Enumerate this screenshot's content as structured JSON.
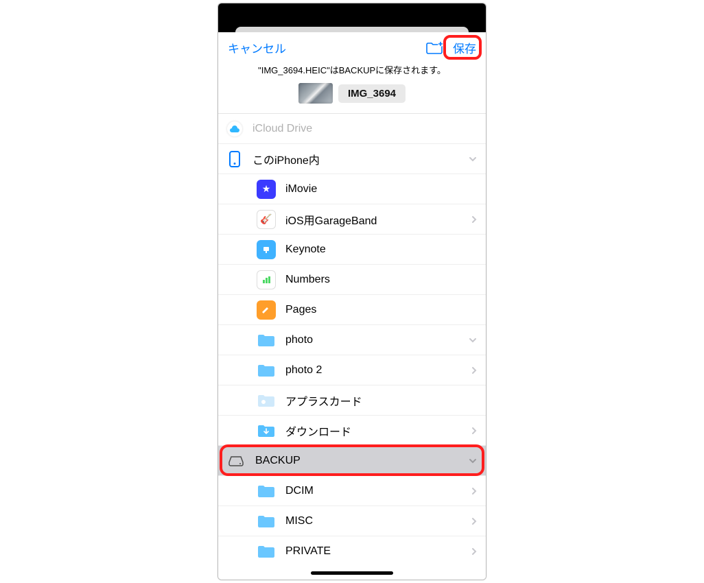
{
  "nav": {
    "cancel": "キャンセル",
    "save": "保存"
  },
  "info": "\"IMG_3694.HEIC\"はBACKUPに保存されます。",
  "file": {
    "name": "IMG_3694"
  },
  "locations": {
    "icloud": "iCloud Drive",
    "iphone": "このiPhone内",
    "items": {
      "imovie": "iMovie",
      "garageband": "iOS用GarageBand",
      "keynote": "Keynote",
      "numbers": "Numbers",
      "pages": "Pages",
      "photo": "photo",
      "photo2": "photo 2",
      "aplus": "アプラスカード",
      "downloads": "ダウンロード"
    },
    "backup": "BACKUP",
    "backup_children": {
      "dcim": "DCIM",
      "misc": "MISC",
      "private": "PRIVATE"
    }
  }
}
